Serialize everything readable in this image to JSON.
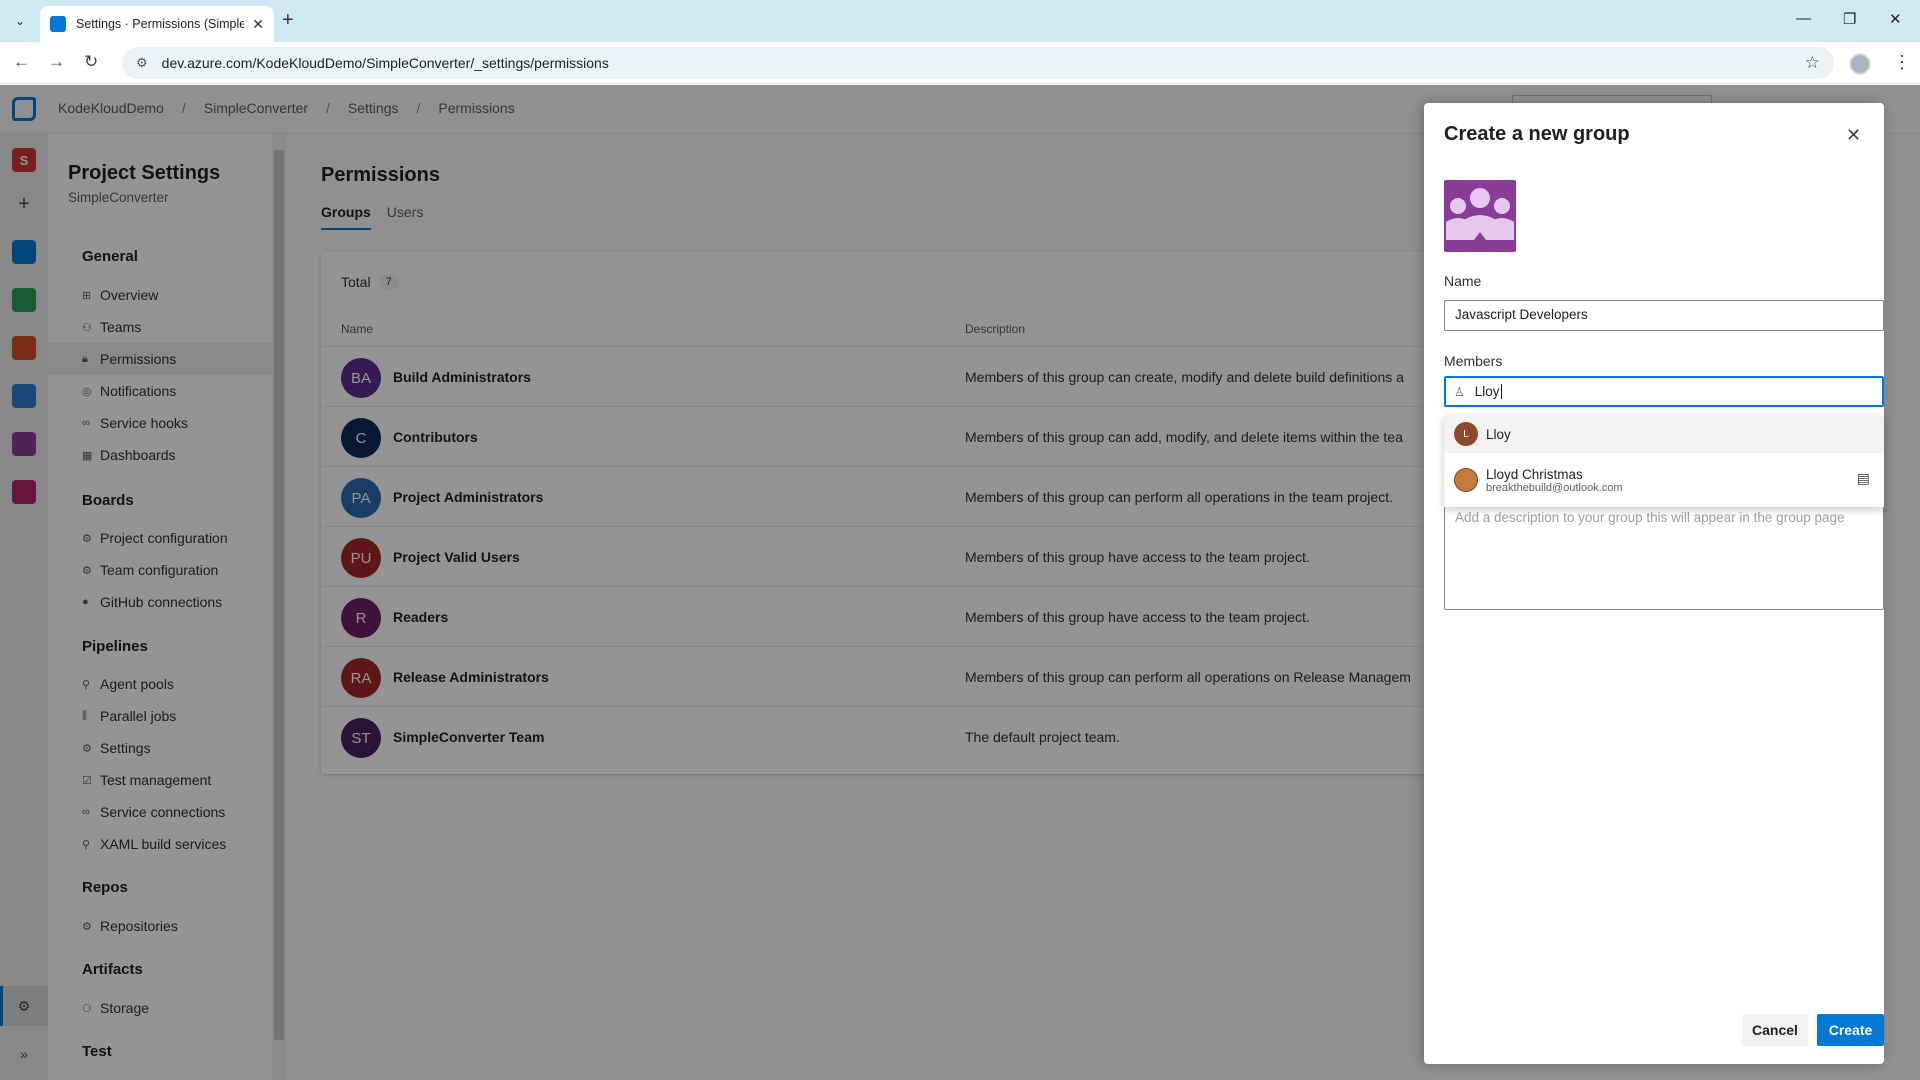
{
  "browser": {
    "tab_title": "Settings · Permissions (SimpleConverter)",
    "url": "dev.azure.com/KodeKloudDemo/SimpleConverter/_settings/permissions"
  },
  "breadcrumb": [
    "KodeKloudDemo",
    "SimpleConverter",
    "Settings",
    "Permissions"
  ],
  "rail": {
    "org_initial": "S",
    "icons": [
      "overview-icon",
      "boards-icon",
      "repos-icon",
      "pipelines-icon",
      "test-plans-icon",
      "artifacts-icon"
    ]
  },
  "settings_nav": {
    "title": "Project Settings",
    "subtitle": "SimpleConverter",
    "sections": [
      {
        "label": "General",
        "items": [
          "Overview",
          "Teams",
          "Permissions",
          "Notifications",
          "Service hooks",
          "Dashboards"
        ]
      },
      {
        "label": "Boards",
        "items": [
          "Project configuration",
          "Team configuration",
          "GitHub connections"
        ]
      },
      {
        "label": "Pipelines",
        "items": [
          "Agent pools",
          "Parallel jobs",
          "Settings",
          "Test management",
          "Service connections",
          "XAML build services"
        ]
      },
      {
        "label": "Repos",
        "items": [
          "Repositories"
        ]
      },
      {
        "label": "Artifacts",
        "items": [
          "Storage"
        ]
      },
      {
        "label": "Test",
        "items": []
      }
    ],
    "selected": "Permissions"
  },
  "main": {
    "title": "Permissions",
    "tabs": [
      "Groups",
      "Users"
    ],
    "active_tab": "Groups",
    "total_label": "Total",
    "total_count": "7",
    "col_name": "Name",
    "col_desc": "Description",
    "groups": [
      {
        "initials": "BA",
        "name": "Build Administrators",
        "desc": "Members of this group can create, modify and delete build definitions a",
        "color": "#5c2d91"
      },
      {
        "initials": "C",
        "name": "Contributors",
        "desc": "Members of this group can add, modify, and delete items within the tea",
        "color": "#0b2a5b"
      },
      {
        "initials": "PA",
        "name": "Project Administrators",
        "desc": "Members of this group can perform all operations in the team project.",
        "color": "#2a6cb0"
      },
      {
        "initials": "PU",
        "name": "Project Valid Users",
        "desc": "Members of this group have access to the team project.",
        "color": "#a4262c"
      },
      {
        "initials": "R",
        "name": "Readers",
        "desc": "Members of this group have access to the team project.",
        "color": "#6b1f62"
      },
      {
        "initials": "RA",
        "name": "Release Administrators",
        "desc": "Members of this group can perform all operations on Release Managem",
        "color": "#a4262c"
      },
      {
        "initials": "ST",
        "name": "SimpleConverter Team",
        "desc": "The default project team.",
        "color": "#4b1f5f"
      }
    ]
  },
  "panel": {
    "title": "Create a new group",
    "name_label": "Name",
    "name_value": "Javascript Developers",
    "members_label": "Members",
    "members_query": "Lloy",
    "suggestions": [
      {
        "initial": "L",
        "name": "Lloy",
        "email": ""
      },
      {
        "initial": "",
        "name": "Lloyd Christmas",
        "email": "breakthebuild@outlook.com"
      }
    ],
    "description_placeholder": "Add a description to your group this will appear in the group page",
    "cancel_label": "Cancel",
    "create_label": "Create"
  }
}
